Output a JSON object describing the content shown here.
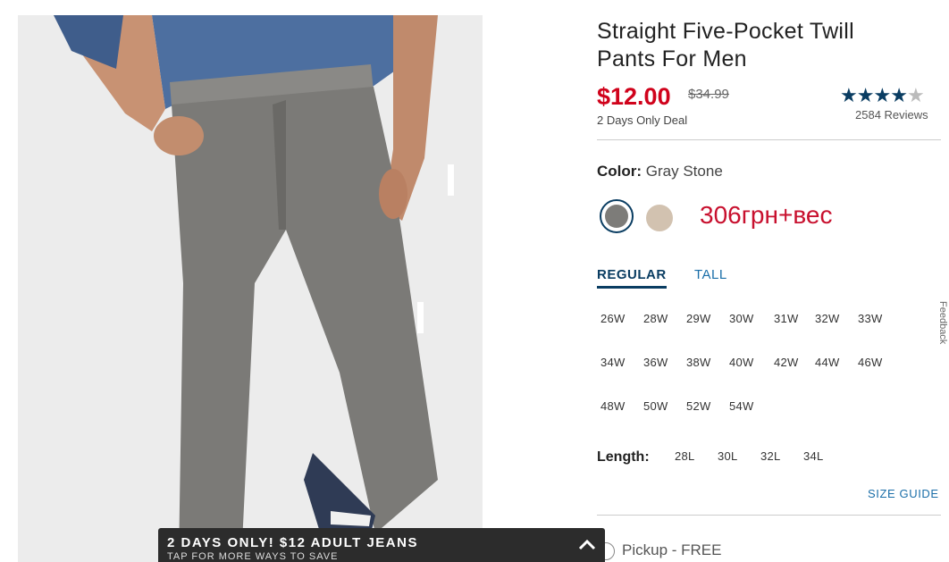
{
  "product": {
    "title": "Straight Five-Pocket Twill Pants For Men",
    "price": "$12.00",
    "original_price": "$34.99",
    "deal": "2 Days Only Deal",
    "rating_stars": 4.5,
    "reviews": "2584 Reviews"
  },
  "color": {
    "label": "Color:",
    "value": "Gray Stone",
    "swatches": [
      {
        "name": "Gray Stone",
        "hex": "#7d7c79",
        "selected": true
      },
      {
        "name": "tan",
        "hex": "#d2c2b0",
        "selected": false
      }
    ],
    "annotation": "306грн+вес"
  },
  "fit_tabs": [
    "REGULAR",
    "TALL"
  ],
  "active_tab": "REGULAR",
  "waist_sizes": [
    "26W",
    "28W",
    "29W",
    "30W",
    "31W",
    "32W",
    "33W",
    "34W",
    "36W",
    "38W",
    "40W",
    "42W",
    "44W",
    "46W",
    "48W",
    "50W",
    "52W",
    "54W"
  ],
  "length": {
    "label": "Length:",
    "sizes": [
      "28L",
      "30L",
      "32L",
      "34L"
    ]
  },
  "size_guide": "SIZE GUIDE",
  "pickup": "Pickup - FREE",
  "feedback": "Feedback",
  "promo": {
    "headline": "2 DAYS ONLY! $12 ADULT JEANS",
    "subline": "TAP FOR MORE WAYS TO SAVE"
  },
  "colors": {
    "accent_navy": "#0a3d62",
    "sale_red": "#d0021b",
    "link_blue": "#1a6ea8",
    "promo_bg": "#2c2c2c"
  }
}
